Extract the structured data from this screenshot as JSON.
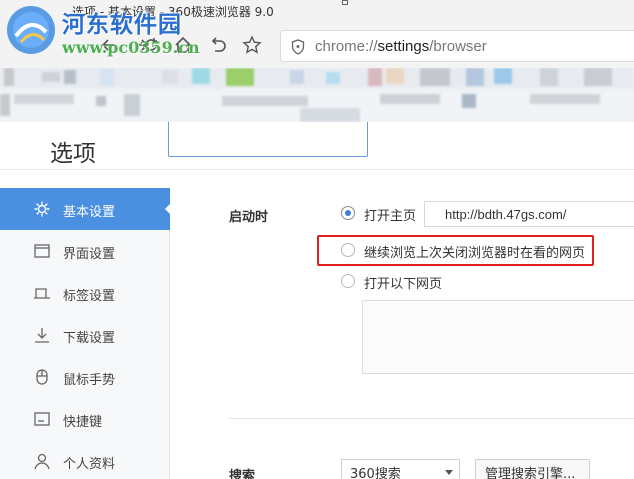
{
  "window": {
    "title": "选项 - 基本设置 - 360极速浏览器 9.0"
  },
  "watermark": {
    "name": "河东软件园",
    "url": "www.pc0359.cn"
  },
  "toolbar": {
    "back_icon": "back-arrow-icon",
    "forward_icon": "forward-arrow-icon",
    "reload_icon": "reload-icon",
    "home_icon": "home-icon",
    "undo_icon": "undo-icon",
    "favorite_icon": "star-icon",
    "address": {
      "security_icon": "shield-icon",
      "scheme": "chrome://",
      "host": "settings",
      "path": "/browser"
    }
  },
  "page": {
    "title": "选项",
    "search_value": ""
  },
  "sidebar": {
    "items": [
      {
        "label": "基本设置",
        "icon": "gear-icon",
        "active": true
      },
      {
        "label": "界面设置",
        "icon": "window-icon",
        "active": false
      },
      {
        "label": "标签设置",
        "icon": "tab-icon",
        "active": false
      },
      {
        "label": "下载设置",
        "icon": "download-icon",
        "active": false
      },
      {
        "label": "鼠标手势",
        "icon": "mouse-icon",
        "active": false
      },
      {
        "label": "快捷键",
        "icon": "keyboard-icon",
        "active": false
      },
      {
        "label": "个人资料",
        "icon": "person-icon",
        "active": false
      }
    ]
  },
  "startup": {
    "label": "启动时",
    "options": [
      {
        "label": "打开主页",
        "checked": true
      },
      {
        "label": "继续浏览上次关闭浏览器时在看的网页",
        "checked": false
      },
      {
        "label": "打开以下网页",
        "checked": false
      }
    ],
    "homepage_value": "http://bdth.47gs.com/"
  },
  "search": {
    "label": "搜索",
    "engine": "360搜索",
    "manage_label": "管理搜索引擎..."
  },
  "colors": {
    "accent": "#4a8fe0",
    "highlight": "#e02020",
    "radio_dot": "#3b7fd8"
  }
}
